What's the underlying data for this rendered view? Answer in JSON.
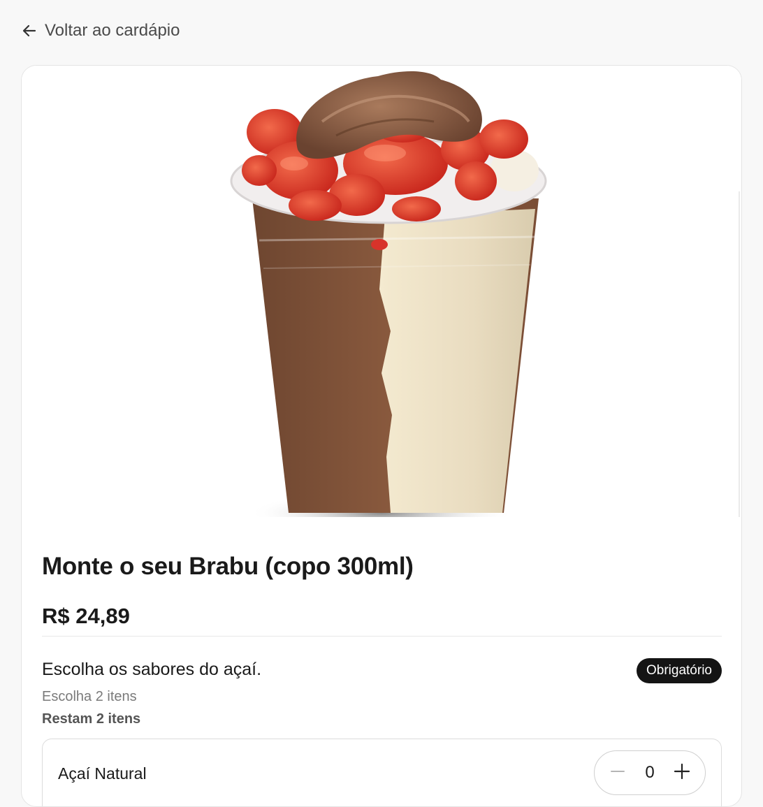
{
  "nav": {
    "back_label": "Voltar ao cardápio"
  },
  "product": {
    "title": "Monte o seu Brabu (copo 300ml)",
    "price": "R$ 24,89"
  },
  "options_group": {
    "title": "Escolha os sabores do açaí.",
    "badge": "Obrigatório",
    "hint": "Escolha 2 itens",
    "remaining": "Restam 2 itens",
    "items": [
      {
        "label": "Açaí Natural",
        "quantity": "0"
      }
    ]
  },
  "colors": {
    "background": "#f8f8f8",
    "card": "#ffffff",
    "badge_bg": "#141414",
    "text_primary": "#1a1a1a",
    "text_muted": "#7a7a7a"
  },
  "icons": {
    "back": "arrow-left-icon",
    "minus": "minus-icon",
    "plus": "plus-icon"
  }
}
